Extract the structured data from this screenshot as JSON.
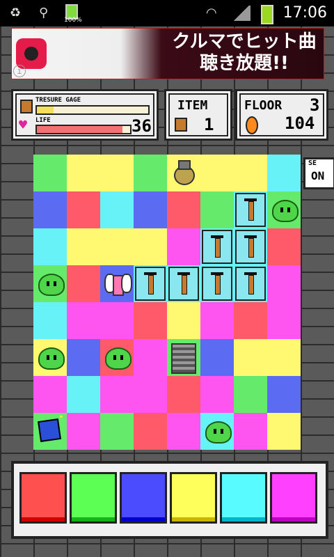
{
  "status": {
    "time": "17:06",
    "battery_pct": "100%"
  },
  "ad": {
    "line1": "クルマでヒット曲",
    "line2": "聴き放題!!",
    "info": "i"
  },
  "hud": {
    "treasure_label": "TRESURE GAGE",
    "treasure_fill": 0.15,
    "life_label": "LIFE",
    "life_value": "36",
    "life_fill": 0.92,
    "item_label": "ITEM",
    "item_count": "1",
    "floor_label": "FLOOR",
    "floor_value": "3",
    "coins": "104"
  },
  "se_toggle": {
    "label": "SE",
    "state": "ON"
  },
  "board": {
    "rows": [
      [
        {
          "c": "#66ea6b"
        },
        {
          "c": "#fff870"
        },
        {
          "c": "#fff870"
        },
        {
          "c": "#66ea6b"
        },
        {
          "c": "#fff870",
          "obj": "bag"
        },
        {
          "c": "#fff870"
        },
        {
          "c": "#fff870"
        },
        {
          "c": "#66f2f7"
        }
      ],
      [
        {
          "c": "#5c6cf2"
        },
        {
          "c": "#ff5a6a"
        },
        {
          "c": "#66f2f7"
        },
        {
          "c": "#5c6cf2"
        },
        {
          "c": "#ff5a6a"
        },
        {
          "c": "#66ea6b"
        },
        {
          "c": "#66f2f7",
          "obj": "pillar"
        },
        {
          "c": "#66ea6b",
          "obj": "slime"
        }
      ],
      [
        {
          "c": "#66f2f7"
        },
        {
          "c": "#fff870"
        },
        {
          "c": "#fff870"
        },
        {
          "c": "#fff870"
        },
        {
          "c": "#ff55f0"
        },
        {
          "c": "#66f2f7",
          "obj": "pillar"
        },
        {
          "c": "#66f2f7",
          "obj": "pillar"
        },
        {
          "c": "#ff5a6a"
        }
      ],
      [
        {
          "c": "#66ea6b",
          "obj": "slime"
        },
        {
          "c": "#ff5a6a"
        },
        {
          "c": "#5c6cf2",
          "obj": "hero"
        },
        {
          "c": "#66f2f7",
          "obj": "pillar"
        },
        {
          "c": "#66f2f7",
          "obj": "pillar"
        },
        {
          "c": "#66f2f7",
          "obj": "pillar"
        },
        {
          "c": "#66f2f7",
          "obj": "pillar"
        },
        {
          "c": "#ff55f0"
        }
      ],
      [
        {
          "c": "#66f2f7"
        },
        {
          "c": "#ff55f0"
        },
        {
          "c": "#ff55f0"
        },
        {
          "c": "#ff5a6a"
        },
        {
          "c": "#fff870"
        },
        {
          "c": "#ff55f0"
        },
        {
          "c": "#ff5a6a"
        },
        {
          "c": "#ff55f0"
        }
      ],
      [
        {
          "c": "#fff870",
          "obj": "slime"
        },
        {
          "c": "#5c6cf2"
        },
        {
          "c": "#ff5a6a",
          "obj": "slime"
        },
        {
          "c": "#ff55f0"
        },
        {
          "c": "#66ea6b",
          "obj": "stairs"
        },
        {
          "c": "#5c6cf2"
        },
        {
          "c": "#fff870"
        },
        {
          "c": "#fff870"
        }
      ],
      [
        {
          "c": "#ff55f0"
        },
        {
          "c": "#66f2f7"
        },
        {
          "c": "#ff55f0"
        },
        {
          "c": "#ff55f0"
        },
        {
          "c": "#ff5a6a"
        },
        {
          "c": "#ff55f0"
        },
        {
          "c": "#66ea6b"
        },
        {
          "c": "#5c6cf2"
        }
      ],
      [
        {
          "c": "#66ea6b",
          "obj": "gem"
        },
        {
          "c": "#ff55f0"
        },
        {
          "c": "#66ea6b"
        },
        {
          "c": "#ff5a6a"
        },
        {
          "c": "#ff55f0"
        },
        {
          "c": "#66f2f7",
          "obj": "slime"
        },
        {
          "c": "#ff55f0"
        },
        {
          "c": "#fff870"
        }
      ]
    ]
  },
  "palette": [
    {
      "name": "red",
      "color": "#ff5050",
      "stripe": "#d00000"
    },
    {
      "name": "green",
      "color": "#5cff53",
      "stripe": "#16b316"
    },
    {
      "name": "blue",
      "color": "#4c4cff",
      "stripe": "#0000cc"
    },
    {
      "name": "yellow",
      "color": "#ffff5c",
      "stripe": "#c8b600"
    },
    {
      "name": "cyan",
      "color": "#58fbff",
      "stripe": "#00b6c8"
    },
    {
      "name": "magenta",
      "color": "#ff40ff",
      "stripe": "#c000c0"
    }
  ]
}
